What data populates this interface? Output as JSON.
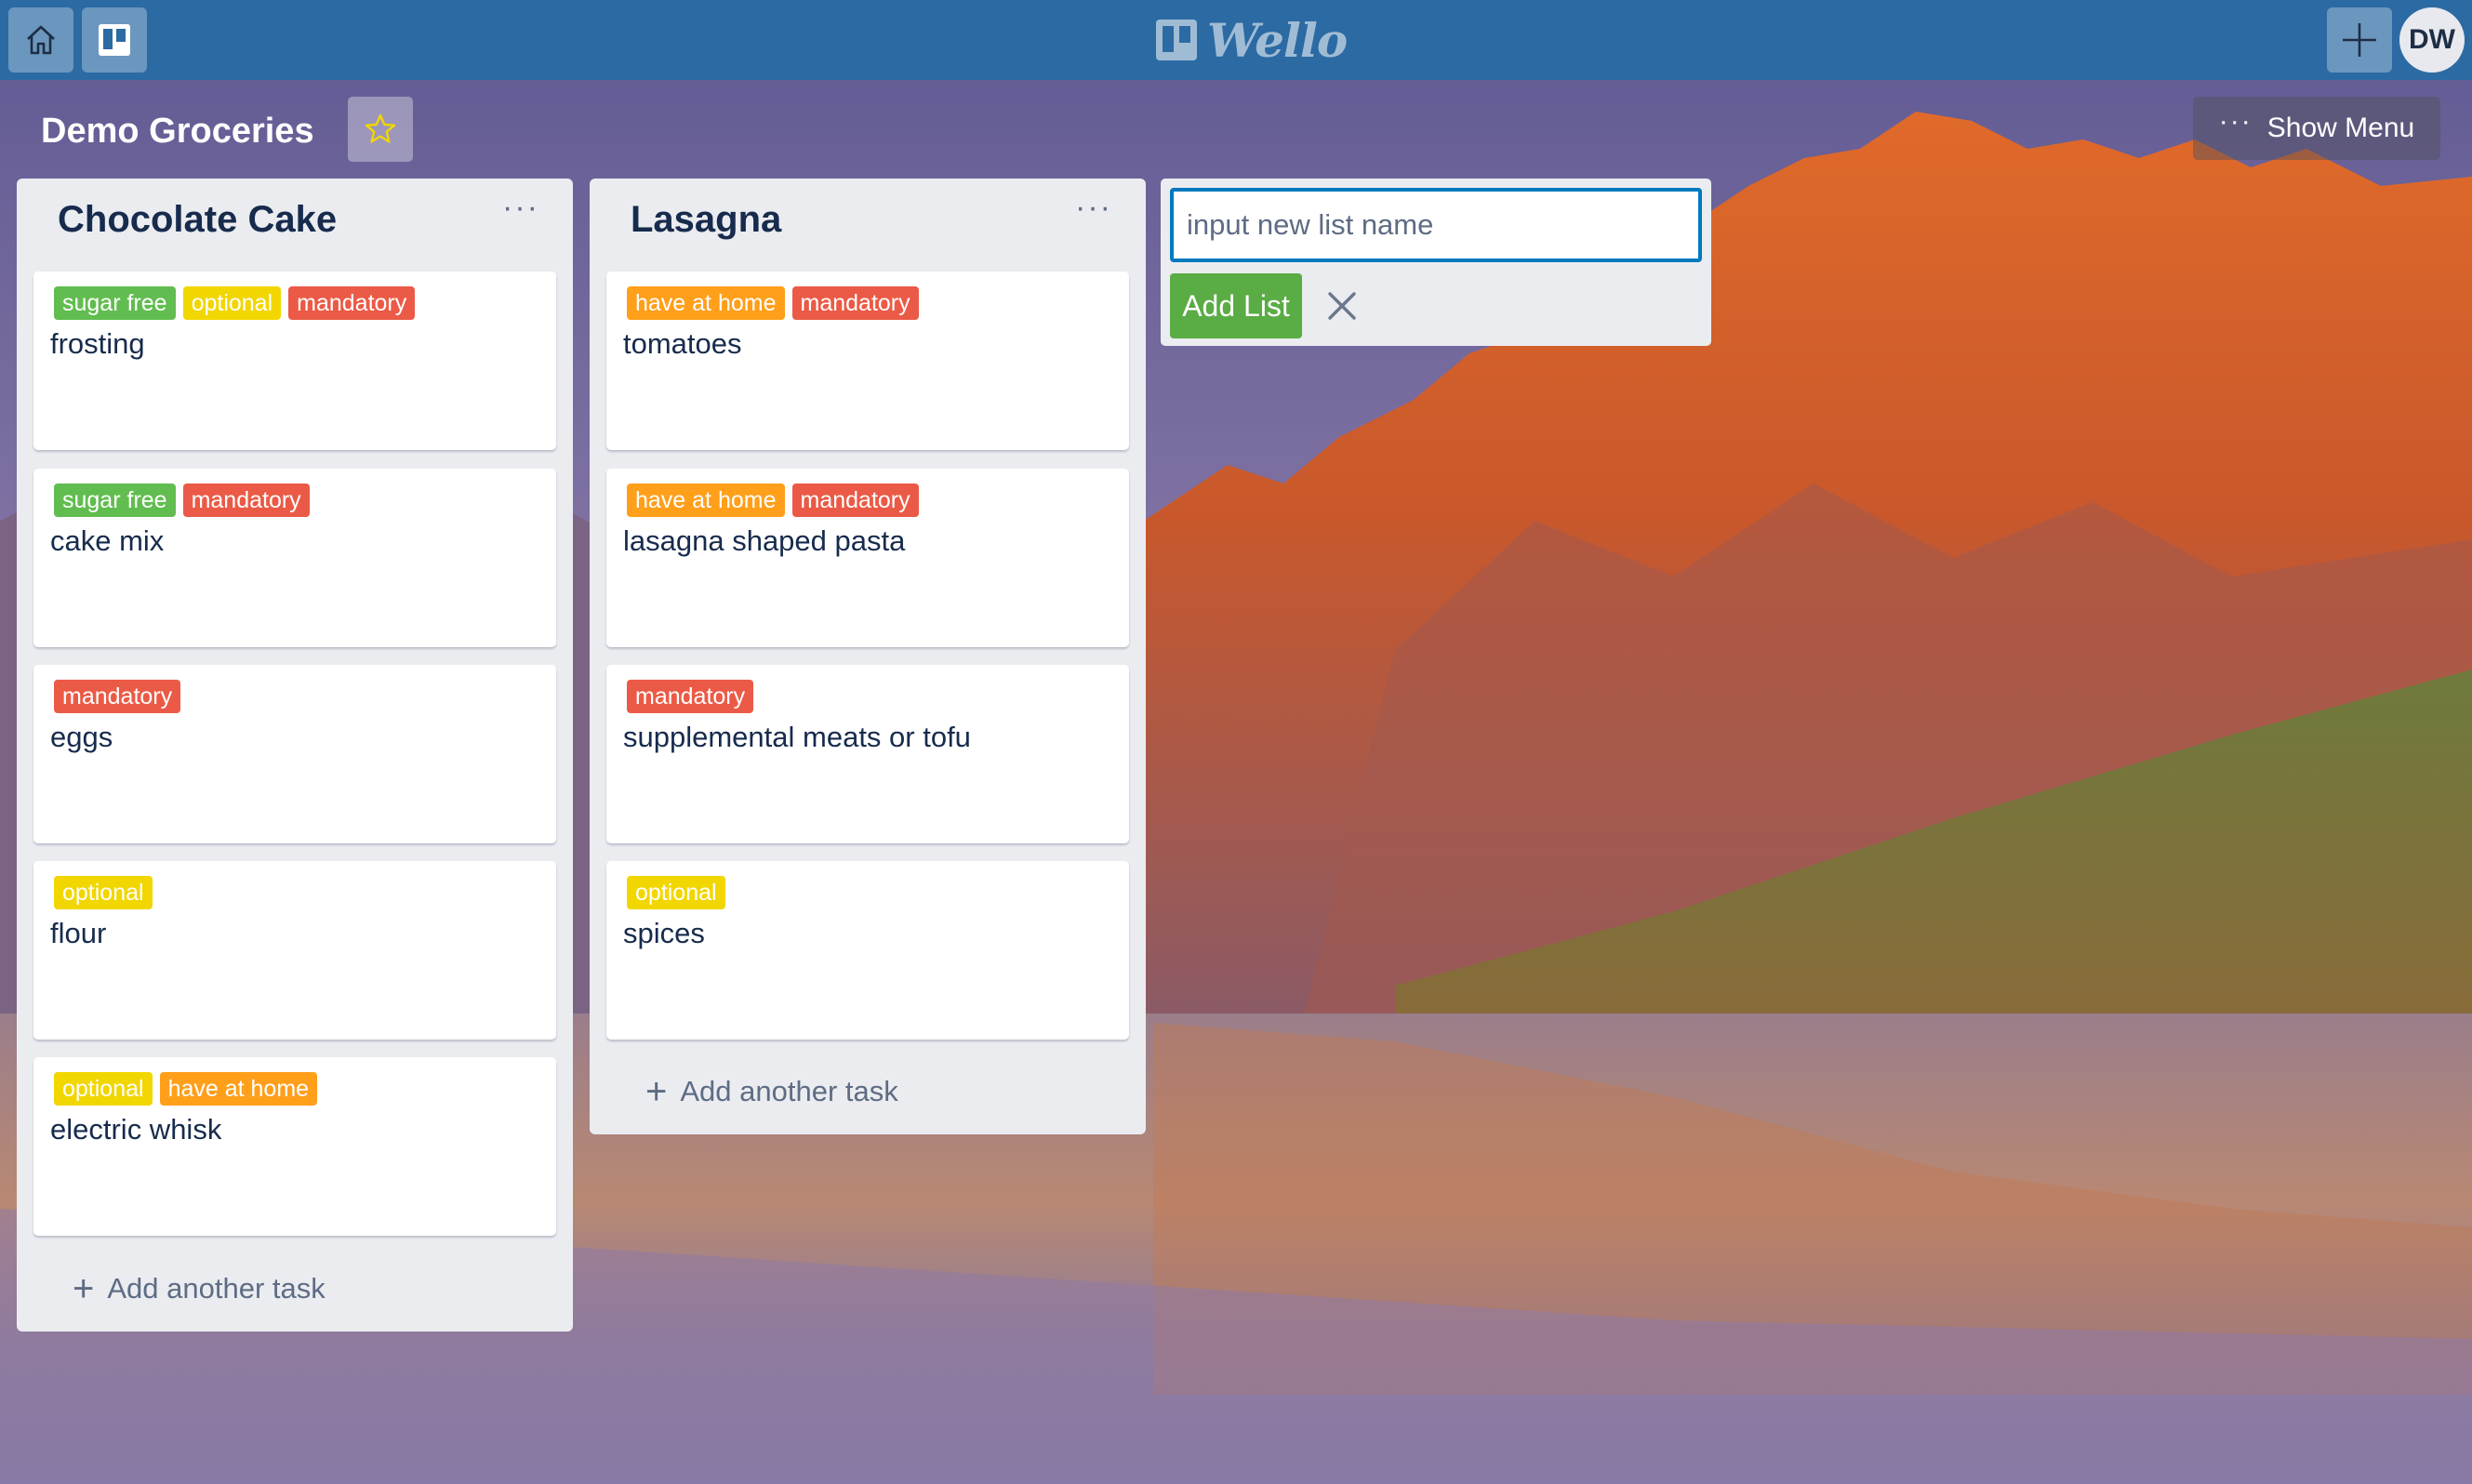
{
  "app": {
    "name": "Wello",
    "user_initials": "DW",
    "icons": {
      "home": "home-icon",
      "boards": "boards-icon",
      "add": "plus-icon",
      "star": "star-icon",
      "menu": "more-icon",
      "close": "close-icon"
    }
  },
  "board": {
    "title": "Demo Groceries",
    "show_menu_label": "Show Menu",
    "menu_dots": "···"
  },
  "label_colors": {
    "sugar free": "#61bd4f",
    "optional": "#f2d600",
    "mandatory": "#eb5a46",
    "have at home": "#ff9f1a"
  },
  "lists": [
    {
      "title": "Chocolate Cake",
      "menu_dots": "···",
      "add_task_label": "Add another task",
      "cards": [
        {
          "labels": [
            "sugar free",
            "optional",
            "mandatory"
          ],
          "title": "frosting"
        },
        {
          "labels": [
            "sugar free",
            "mandatory"
          ],
          "title": "cake mix"
        },
        {
          "labels": [
            "mandatory"
          ],
          "title": "eggs"
        },
        {
          "labels": [
            "optional"
          ],
          "title": "flour"
        },
        {
          "labels": [
            "optional",
            "have at home"
          ],
          "title": "electric whisk"
        }
      ]
    },
    {
      "title": "Lasagna",
      "menu_dots": "···",
      "add_task_label": "Add another task",
      "cards": [
        {
          "labels": [
            "have at home",
            "mandatory"
          ],
          "title": "tomatoes"
        },
        {
          "labels": [
            "have at home",
            "mandatory"
          ],
          "title": "lasagna shaped pasta"
        },
        {
          "labels": [
            "mandatory"
          ],
          "title": "supplemental meats or tofu"
        },
        {
          "labels": [
            "optional"
          ],
          "title": "spices"
        }
      ]
    }
  ],
  "composer": {
    "placeholder": "input new list name",
    "value": "",
    "add_button_label": "Add List"
  }
}
